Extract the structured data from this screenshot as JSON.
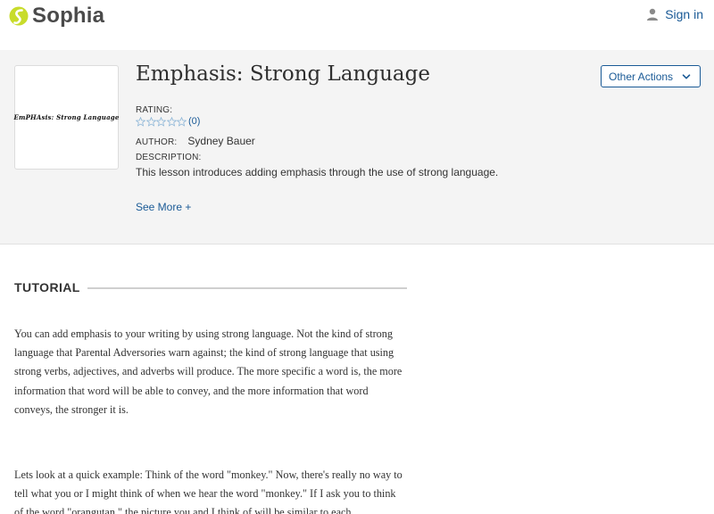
{
  "header": {
    "logo_text": "Sophia",
    "signin_label": "Sign in",
    "icons": [
      "sophia-logo-icon",
      "user-icon"
    ]
  },
  "lesson": {
    "thumbnail_text": "EmPHAsis: Strong Language",
    "title": "Emphasis: Strong Language",
    "rating_label": "RATING:",
    "rating_count": "(0)",
    "rating_stars": 0,
    "author_label": "AUTHOR:",
    "author_name": "Sydney Bauer",
    "description_label": "DESCRIPTION:",
    "description": "This lesson introduces adding emphasis through the use of strong language.",
    "see_more_label": "See More +",
    "other_actions_label": "Other Actions"
  },
  "tutorial": {
    "label": "TUTORIAL",
    "paragraphs": [
      "You can add emphasis to your writing by using strong language. Not the kind of strong language that Parental Adversories warn against; the kind of strong language that using strong verbs, adjectives, and adverbs will produce. The more specific a word is, the more information that word will be able to convey, and the more information that word conveys, the stronger it is.",
      "Lets look at a quick example: Think of the word \"monkey.\" Now, there's really no way to tell what you or I might think of when we hear the word \"monkey.\" If I ask you to think of the word \"orangutan,\" the picture you and I think of will be similar to each"
    ]
  },
  "colors": {
    "accent": "#1a5a96",
    "logo_green": "#c8dc2b",
    "band_bg": "#f4f4f4"
  }
}
